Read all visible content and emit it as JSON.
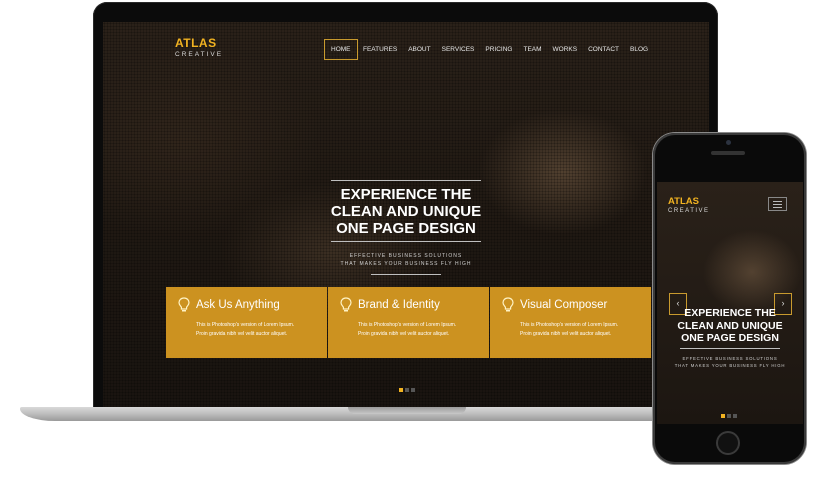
{
  "site": {
    "logo": {
      "main": "ATLAS",
      "sub": "CREATIVE"
    },
    "nav": [
      "HOME",
      "FEATURES",
      "ABOUT",
      "SERVICES",
      "PRICING",
      "TEAM",
      "WORKS",
      "CONTACT",
      "BLOG"
    ],
    "active_nav": "HOME",
    "hero": {
      "title_lines": [
        "EXPERIENCE THE",
        "CLEAN AND UNIQUE",
        "ONE PAGE DESIGN"
      ],
      "subtitle_lines": [
        "EFFECTIVE BUSINESS SOLUTIONS",
        "THAT MAKES YOUR BUSINESS FLY HIGH"
      ]
    },
    "features": [
      {
        "icon": "lightbulb-icon",
        "title": "Ask Us Anything",
        "desc_lines": [
          "This is Photoshop's version of Lorem Ipsum.",
          "Proin gravida nibh vel velit auctor aliquet."
        ]
      },
      {
        "icon": "lightbulb-icon",
        "title": "Brand & Identity",
        "desc_lines": [
          "This is Photoshop's version of Lorem Ipsum.",
          "Proin gravida nibh vel velit auctor aliquet."
        ]
      },
      {
        "icon": "lightbulb-icon",
        "title": "Visual Composer",
        "desc_lines": [
          "This is Photoshop's version of Lorem Ipsum.",
          "Proin gravida nibh vel velit auctor aliquet."
        ]
      }
    ],
    "slider": {
      "slides": 3,
      "active": 1
    },
    "phone_arrows": {
      "prev": "‹",
      "next": "›"
    }
  },
  "colors": {
    "accent": "#f2b321",
    "feature_bg": "#cc9220",
    "screen_bg": "#221a14"
  }
}
